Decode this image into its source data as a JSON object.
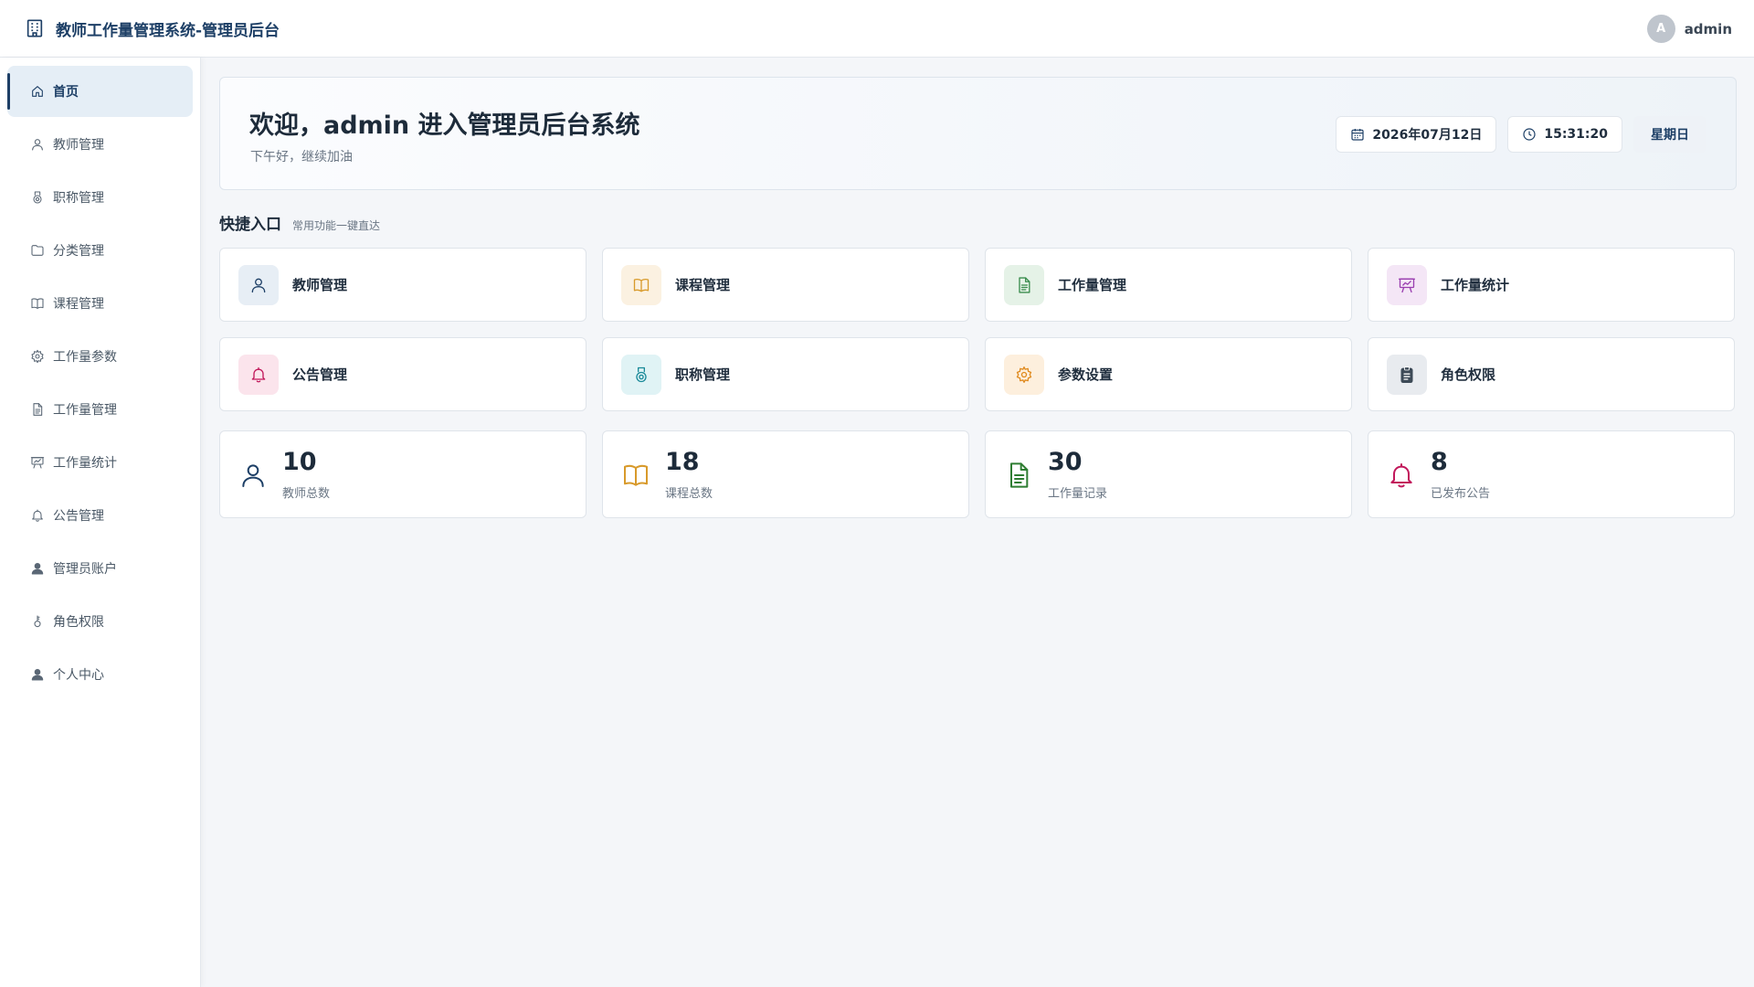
{
  "header": {
    "title": "教师工作量管理系统-管理员后台",
    "logo_icon": "building-icon",
    "avatar_initial": "A",
    "username": "admin"
  },
  "sidebar": {
    "items": [
      {
        "label": "首页",
        "icon": "home-icon",
        "active": true
      },
      {
        "label": "教师管理",
        "icon": "user-icon"
      },
      {
        "label": "职称管理",
        "icon": "medal-icon"
      },
      {
        "label": "分类管理",
        "icon": "folder-icon"
      },
      {
        "label": "课程管理",
        "icon": "book-icon"
      },
      {
        "label": "工作量参数",
        "icon": "gear-icon"
      },
      {
        "label": "工作量管理",
        "icon": "document-icon"
      },
      {
        "label": "工作量统计",
        "icon": "presentation-icon"
      },
      {
        "label": "公告管理",
        "icon": "bell-icon"
      },
      {
        "label": "管理员账户",
        "icon": "person-filled-icon"
      },
      {
        "label": "角色权限",
        "icon": "key-icon"
      },
      {
        "label": "个人中心",
        "icon": "person-filled-icon"
      }
    ]
  },
  "welcome": {
    "title": "欢迎，admin 进入管理员后台系统",
    "subtitle": "下午好，继续加油",
    "date": "2026年07月12日",
    "time": "15:31:20",
    "weekday": "星期日"
  },
  "quick": {
    "title": "快捷入口",
    "subtitle": "常用功能一键直达",
    "items": [
      {
        "label": "教师管理",
        "icon": "user-icon",
        "color": "#1d3f66",
        "bg": "#e7eef5"
      },
      {
        "label": "课程管理",
        "icon": "book-icon",
        "color": "#d89a2b",
        "bg": "#fbf1e1"
      },
      {
        "label": "工作量管理",
        "icon": "document-icon",
        "color": "#3a8c4d",
        "bg": "#e5f2e7"
      },
      {
        "label": "工作量统计",
        "icon": "presentation-icon",
        "color": "#9a3fb0",
        "bg": "#f4e6f6"
      },
      {
        "label": "公告管理",
        "icon": "bell-icon",
        "color": "#c2185b",
        "bg": "#fbe4ec"
      },
      {
        "label": "职称管理",
        "icon": "medal-icon",
        "color": "#1a8a99",
        "bg": "#e0f3f5"
      },
      {
        "label": "参数设置",
        "icon": "gear-icon",
        "color": "#e08a1e",
        "bg": "#fdefdd"
      },
      {
        "label": "角色权限",
        "icon": "clipboard-icon",
        "color": "#3d4a57",
        "bg": "#e8ebef"
      }
    ]
  },
  "stats": [
    {
      "value": "10",
      "label": "教师总数",
      "icon": "user-icon",
      "color": "#1d3f66"
    },
    {
      "value": "18",
      "label": "课程总数",
      "icon": "book-icon",
      "color": "#d89a2b"
    },
    {
      "value": "30",
      "label": "工作量记录",
      "icon": "document-icon",
      "color": "#2e7d32"
    },
    {
      "value": "8",
      "label": "已发布公告",
      "icon": "bell-icon",
      "color": "#c2185b"
    }
  ]
}
